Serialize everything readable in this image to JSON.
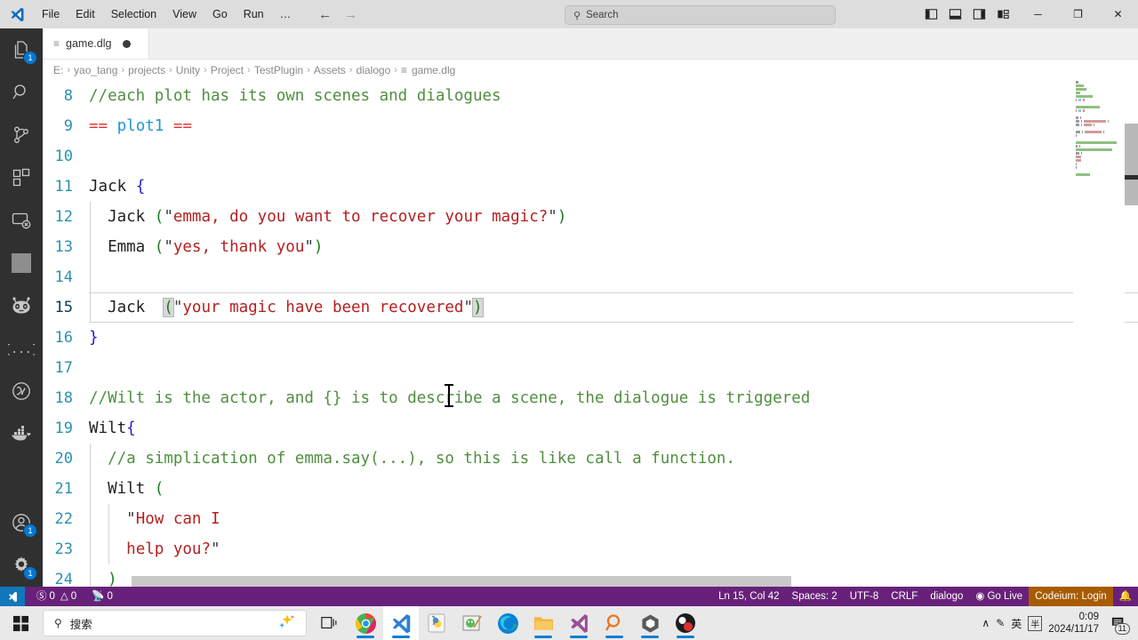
{
  "titlebar": {
    "menu": [
      "File",
      "Edit",
      "Selection",
      "View",
      "Go",
      "Run",
      "…"
    ],
    "back_icon": "←",
    "forward_icon": "→",
    "search_placeholder": "Search",
    "search_icon": "search-icon",
    "window_controls": {
      "minimize": "─",
      "restore": "❐",
      "close": "✕"
    }
  },
  "activitybar": {
    "items": [
      {
        "name": "explorer",
        "badge": "1"
      },
      {
        "name": "search",
        "badge": ""
      },
      {
        "name": "source-control",
        "badge": ""
      },
      {
        "name": "extensions",
        "badge": ""
      },
      {
        "name": "remote-explorer",
        "badge": ""
      },
      {
        "name": "square-view",
        "badge": ""
      },
      {
        "name": "bot-assistant",
        "badge": ""
      },
      {
        "name": "snippets-braces",
        "badge": ""
      },
      {
        "name": "lambda-circle",
        "badge": ""
      },
      {
        "name": "docker",
        "badge": ""
      }
    ],
    "bottom": [
      {
        "name": "accounts",
        "badge": "1"
      },
      {
        "name": "settings-gear",
        "badge": "1"
      }
    ]
  },
  "tab": {
    "label": "game.dlg",
    "file_icon": "≡",
    "dirty": true
  },
  "breadcrumb": {
    "parts": [
      "E:",
      "yao_tang",
      "projects",
      "Unity",
      "Project",
      "TestPlugin",
      "Assets",
      "dialogo"
    ],
    "separator": "›",
    "file": "game.dlg",
    "file_icon": "≡"
  },
  "editor": {
    "first_visible_line": 8,
    "lines": [
      {
        "num": 8,
        "indent": 0,
        "active": false,
        "tokens": [
          {
            "t": "//each plot has its own scenes and dialogues",
            "c": "comment"
          }
        ]
      },
      {
        "num": 9,
        "indent": 0,
        "active": false,
        "tokens": [
          {
            "t": "==",
            "c": "op"
          },
          {
            "t": " ",
            "c": "plain"
          },
          {
            "t": "plot1",
            "c": "tag"
          },
          {
            "t": " ",
            "c": "plain"
          },
          {
            "t": "==",
            "c": "op"
          }
        ]
      },
      {
        "num": 10,
        "indent": 0,
        "active": false,
        "tokens": []
      },
      {
        "num": 11,
        "indent": 0,
        "active": false,
        "tokens": [
          {
            "t": "Jack ",
            "c": "ident"
          },
          {
            "t": "{",
            "c": "brace"
          }
        ]
      },
      {
        "num": 12,
        "indent": 1,
        "active": false,
        "tokens": [
          {
            "t": "  Jack ",
            "c": "ident"
          },
          {
            "t": "(",
            "c": "paren"
          },
          {
            "t": "\"",
            "c": "quote"
          },
          {
            "t": "emma, do you want to recover your magic?",
            "c": "str"
          },
          {
            "t": "\"",
            "c": "quote"
          },
          {
            "t": ")",
            "c": "paren"
          }
        ]
      },
      {
        "num": 13,
        "indent": 1,
        "active": false,
        "tokens": [
          {
            "t": "  Emma ",
            "c": "ident"
          },
          {
            "t": "(",
            "c": "paren"
          },
          {
            "t": "\"",
            "c": "quote"
          },
          {
            "t": "yes, thank you",
            "c": "str"
          },
          {
            "t": "\"",
            "c": "quote"
          },
          {
            "t": ")",
            "c": "paren"
          }
        ]
      },
      {
        "num": 14,
        "indent": 1,
        "active": false,
        "tokens": []
      },
      {
        "num": 15,
        "indent": 1,
        "active": true,
        "tokens": [
          {
            "t": "  Jack  ",
            "c": "ident"
          },
          {
            "t": "(",
            "c": "paren",
            "hl": true
          },
          {
            "t": "\"",
            "c": "quote"
          },
          {
            "t": "your magic have been recovered",
            "c": "str"
          },
          {
            "t": "\"",
            "c": "quote"
          },
          {
            "t": ")",
            "c": "paren",
            "hl": true
          }
        ]
      },
      {
        "num": 16,
        "indent": 0,
        "active": false,
        "tokens": [
          {
            "t": "}",
            "c": "brace"
          }
        ]
      },
      {
        "num": 17,
        "indent": 0,
        "active": false,
        "tokens": []
      },
      {
        "num": 18,
        "indent": 0,
        "active": false,
        "tokens": [
          {
            "t": "//Wilt is the actor, and {} is to describe a scene, the dialogue is triggered",
            "c": "comment"
          }
        ]
      },
      {
        "num": 19,
        "indent": 0,
        "active": false,
        "tokens": [
          {
            "t": "Wilt",
            "c": "ident"
          },
          {
            "t": "{",
            "c": "brace"
          }
        ]
      },
      {
        "num": 20,
        "indent": 1,
        "active": false,
        "tokens": [
          {
            "t": "  //a simplication of emma.say(...), so this is like call a function.",
            "c": "comment"
          }
        ]
      },
      {
        "num": 21,
        "indent": 1,
        "active": false,
        "tokens": [
          {
            "t": "  Wilt ",
            "c": "ident"
          },
          {
            "t": "(",
            "c": "paren"
          }
        ]
      },
      {
        "num": 22,
        "indent": 2,
        "active": false,
        "tokens": [
          {
            "t": "    ",
            "c": "plain"
          },
          {
            "t": "\"",
            "c": "quote"
          },
          {
            "t": "How can I",
            "c": "str"
          }
        ]
      },
      {
        "num": 23,
        "indent": 2,
        "active": false,
        "tokens": [
          {
            "t": "    ",
            "c": "plain"
          },
          {
            "t": "help you?",
            "c": "str"
          },
          {
            "t": "\"",
            "c": "quote"
          }
        ]
      },
      {
        "num": 24,
        "indent": 1,
        "active": false,
        "tokens": [
          {
            "t": "  )",
            "c": "paren"
          }
        ]
      }
    ]
  },
  "statusbar": {
    "remote_icon": "remote-window-icon",
    "errors_icon": "error-icon",
    "errors": "0",
    "warnings_icon": "warning-icon",
    "warnings": "0",
    "ports_icon": "radio-tower-icon",
    "ports": "0",
    "cursor_position": "Ln 15, Col 42",
    "indentation": "Spaces: 2",
    "encoding": "UTF-8",
    "eol": "CRLF",
    "language": "dialogo",
    "golive_icon": "broadcast-icon",
    "golive": "Go Live",
    "codeium": "Codeium: Login",
    "bell_icon": "bell-icon"
  },
  "taskbar": {
    "start_icon": "windows-start-icon",
    "search_icon": "search-icon",
    "search_text": "搜索",
    "copilot_icon": "copilot-sparkle-icon",
    "apps": [
      {
        "name": "task-view",
        "active": false,
        "running": false
      },
      {
        "name": "google-chrome",
        "active": false,
        "running": true
      },
      {
        "name": "visual-studio-code",
        "active": true,
        "running": true
      },
      {
        "name": "pycharm",
        "active": false,
        "running": false
      },
      {
        "name": "green-notepad-app",
        "active": false,
        "running": false
      },
      {
        "name": "microsoft-edge",
        "active": false,
        "running": false
      },
      {
        "name": "file-explorer",
        "active": false,
        "running": true
      },
      {
        "name": "visual-studio",
        "active": false,
        "running": true
      },
      {
        "name": "everything-search",
        "active": false,
        "running": true
      },
      {
        "name": "unity",
        "active": false,
        "running": true
      },
      {
        "name": "obs-studio",
        "active": false,
        "running": true
      }
    ],
    "tray": {
      "chevron": "∧",
      "pen_icon": "pen-icon",
      "ime": "英",
      "ime_box": "半"
    },
    "time": "0:09",
    "date": "2024/11/17",
    "notification_count": "11"
  }
}
